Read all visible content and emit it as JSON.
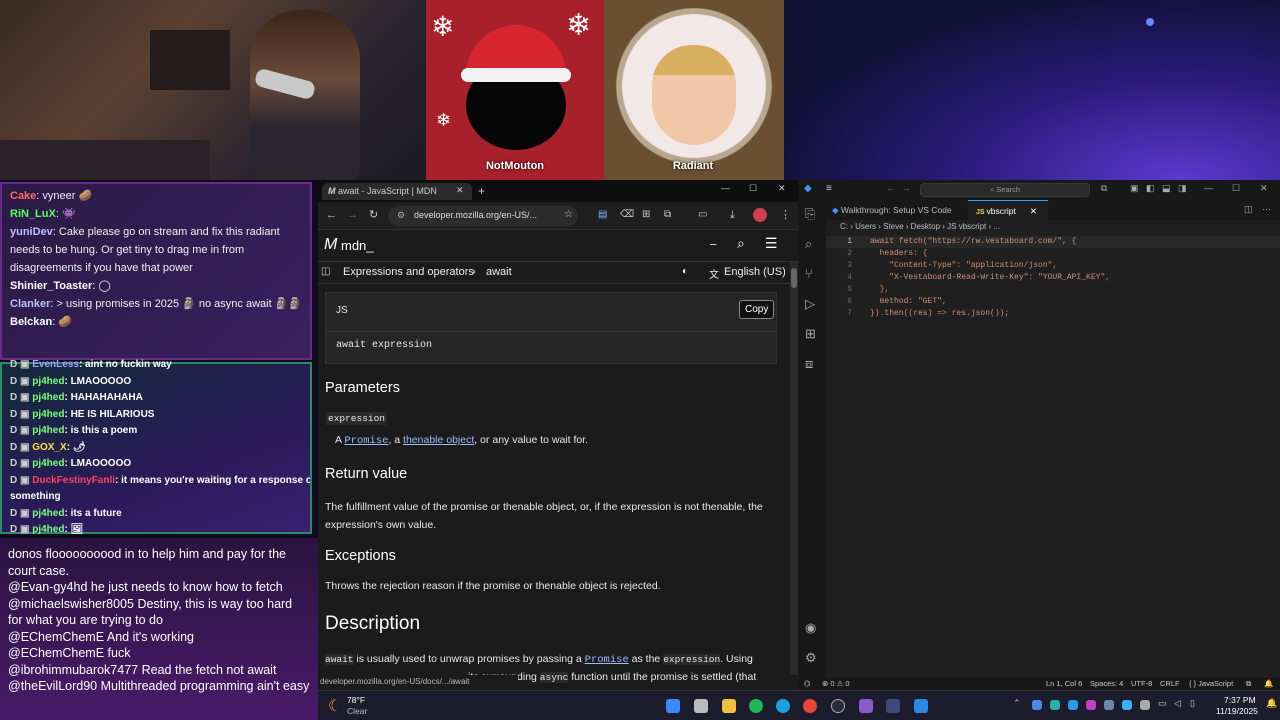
{
  "stream": {
    "cam_panels": [
      {
        "name": "NotMouton"
      },
      {
        "name": "Radiant"
      }
    ]
  },
  "chat_top": [
    {
      "user": "Cake",
      "color": "#ff6b6b",
      "text": "vyneer 🥔"
    },
    {
      "user": "RiN_LuX",
      "color": "#5aff5a",
      "text": "👾"
    },
    {
      "user": "yuniDev",
      "color": "#c0c0ff",
      "text": "Cake please go on stream and fix this radiant"
    },
    {
      "user": "",
      "color": "#ffffff",
      "text": "needs to be hung. Or get tiny to drag me in from"
    },
    {
      "user": "",
      "color": "#ffffff",
      "text": "disagreements if you have that power"
    },
    {
      "user": "Shinier_Toaster",
      "color": "#ffffff",
      "text": "◯"
    },
    {
      "user": "Clanker",
      "color": "#c0c0ff",
      "text": "> using promises in 2025 🗿 no async await 🗿🗿"
    },
    {
      "user": "Belckan",
      "color": "#ffffff",
      "text": "🥔"
    }
  ],
  "chat_mid": [
    {
      "user": "EvenLess",
      "color": "#a0a0ff",
      "text": "aint no fuckin way"
    },
    {
      "user": "pj4hed",
      "color": "#7aff7a",
      "text": "LMAOOOOO"
    },
    {
      "user": "pj4hed",
      "color": "#7aff7a",
      "text": "HAHAHAHAHA"
    },
    {
      "user": "pj4hed",
      "color": "#7aff7a",
      "text": "HE IS HILARIOUS"
    },
    {
      "user": "pj4hed",
      "color": "#7aff7a",
      "text": "is this a poem"
    },
    {
      "user": "GOX_X",
      "color": "#ffe040",
      "text": "🌶"
    },
    {
      "user": "pj4hed",
      "color": "#7aff7a",
      "text": "LMAOOOOO"
    },
    {
      "user": "DuckFestinyFanli",
      "color": "#ff4060",
      "text": "it means you're waiting for a response or"
    },
    {
      "user": "",
      "color": "#ffffff",
      "text": "something"
    },
    {
      "user": "pj4hed",
      "color": "#7aff7a",
      "text": "its a future"
    },
    {
      "user": "pj4hed",
      "color": "#7aff7a",
      "text": "🖼"
    }
  ],
  "chat_bottom": [
    {
      "user": "",
      "text": "donos floooooooood in to help him and pay for the court case."
    },
    {
      "user": "@Evan-gy4hd",
      "text": "he just needs to know how to fetch"
    },
    {
      "user": "@michaelswisher8005",
      "text": "Destiny, this is way too hard for what you are trying to do"
    },
    {
      "user": "@EChemChemE",
      "text": "And it's working"
    },
    {
      "user": "@EChemChemE",
      "text": "fuck"
    },
    {
      "user": "@ibrohimmubarok7477",
      "text": "Read the fetch not await"
    },
    {
      "user": "@theEvilLord90",
      "text": "Multithreaded programming ain't easy"
    }
  ],
  "browser": {
    "tab_title": "await - JavaScript | MDN",
    "url": "developer.mozilla.org/en-US/...",
    "logo": "mdn_",
    "breadcrumb": [
      "Expressions and operators",
      "await"
    ],
    "language": "English (US)",
    "code_lang": "JS",
    "copy_label": "Copy",
    "syntax": "await expression",
    "params_heading": "Parameters",
    "param_name": "expression",
    "param_desc_a": "A ",
    "param_link1": "Promise",
    "param_desc_b": ", a ",
    "param_link2": "thenable object",
    "param_desc_c": ", or any value to wait for.",
    "return_heading": "Return value",
    "return_text": "The fulfillment value of the promise or thenable object, or, if the expression is not thenable, the expression's own value.",
    "exceptions_heading": "Exceptions",
    "exceptions_text": "Throws the rejection reason if the promise or thenable object is rejected.",
    "description_heading": "Description",
    "desc_code1": "await",
    "desc_t1": " is usually used to unwrap promises by passing a ",
    "desc_link": "Promise",
    "desc_t2": " as the ",
    "desc_code2": "expression",
    "desc_t3": ". Using",
    "desc_t4": " its surrounding ",
    "desc_code3": "async",
    "desc_t5": " function until the promise is settled (that",
    "status_url": "developer.mozilla.org/en-US/docs/.../await"
  },
  "vscode": {
    "search_placeholder": "Search",
    "tab1": "Walkthrough: Setup VS Code",
    "tab2": "vbscript",
    "breadcrumb": "C: › Users › Steve › Desktop › JS vbscript › ...",
    "lines": [
      {
        "n": "1",
        "code": "await fetch(\"https://rw.vestaboard.com/\", {"
      },
      {
        "n": "2",
        "code": "  headers: {"
      },
      {
        "n": "3",
        "code": "    \"Content-Type\": \"application/json\","
      },
      {
        "n": "4",
        "code": "    \"X-Vestaboard-Read-Write-Key\": \"YOUR_API_KEY\","
      },
      {
        "n": "5",
        "code": "  },"
      },
      {
        "n": "6",
        "code": "  method: \"GET\","
      },
      {
        "n": "7",
        "code": "}).then((res) => res.json());"
      }
    ],
    "status_left": "⊗ 0 ⚠ 0",
    "status_pos": "Ln 1, Col 6",
    "status_spaces": "Spaces: 4",
    "status_enc": "UTF-8",
    "status_eol": "CRLF",
    "status_lang": "{ } JavaScript"
  },
  "taskbar": {
    "weather_temp": "78°F",
    "weather_desc": "Clear",
    "time": "7:37 PM",
    "date": "11/19/2025"
  }
}
